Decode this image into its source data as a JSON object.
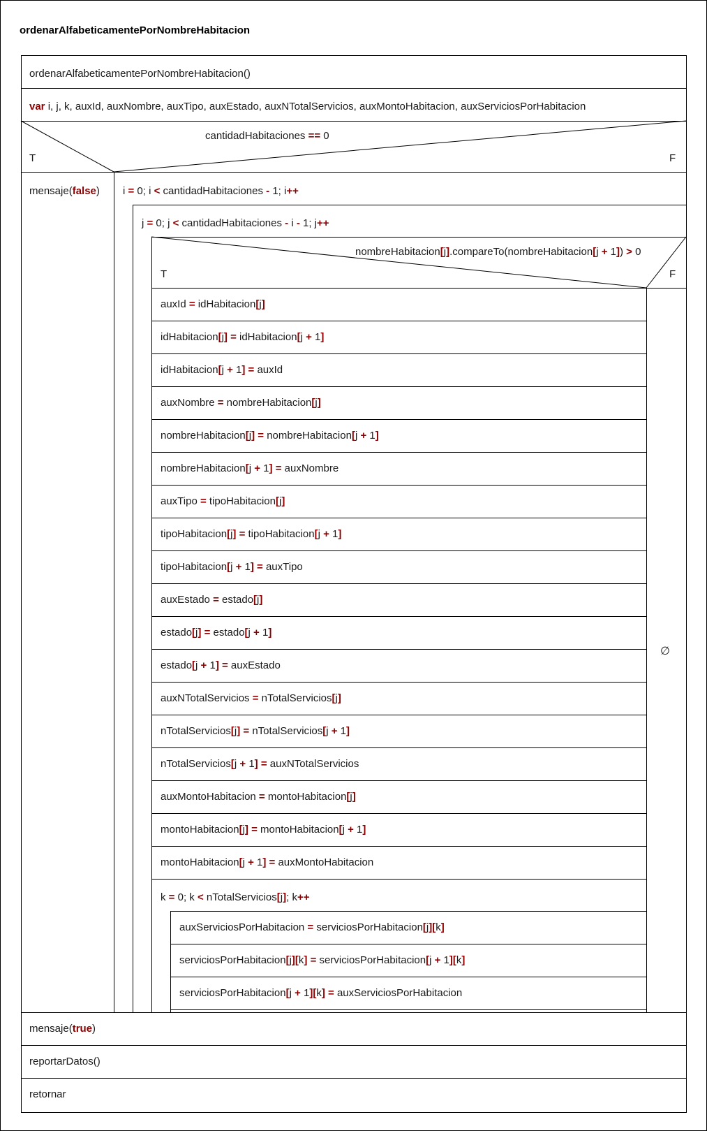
{
  "diagram": {
    "title": "ordenarAlfabeticamentePorNombreHabitacion",
    "header": [
      {
        "t": "ordenarAlfabeticamentePorNombreHabitacion()"
      }
    ],
    "var_line": [
      {
        "t": "var",
        "k": true
      },
      {
        "t": " i, j, k, auxId, auxNombre, auxTipo, auxEstado, auxNTotalServicios, auxMontoHabitacion, auxServiciosPorHabitacion"
      }
    ],
    "if1": {
      "condition": [
        {
          "t": "cantidadHabitaciones "
        },
        {
          "t": "==",
          "k": true
        },
        {
          "t": " 0"
        }
      ],
      "true_label": "T",
      "false_label": "F",
      "true_branch": [
        {
          "t": "mensaje("
        },
        {
          "t": "false",
          "k": true
        },
        {
          "t": ")"
        }
      ]
    },
    "loop_i": [
      {
        "t": "i "
      },
      {
        "t": "=",
        "k": true
      },
      {
        "t": " 0; i "
      },
      {
        "t": "<",
        "k": true
      },
      {
        "t": " cantidadHabitaciones "
      },
      {
        "t": "-",
        "k": true
      },
      {
        "t": " 1; i"
      },
      {
        "t": "++",
        "k": true
      }
    ],
    "loop_j": [
      {
        "t": "j "
      },
      {
        "t": "=",
        "k": true
      },
      {
        "t": " 0; j "
      },
      {
        "t": "<",
        "k": true
      },
      {
        "t": " cantidadHabitaciones "
      },
      {
        "t": "-",
        "k": true
      },
      {
        "t": " i "
      },
      {
        "t": "-",
        "k": true
      },
      {
        "t": " 1; j"
      },
      {
        "t": "++",
        "k": true
      }
    ],
    "if2": {
      "condition": [
        {
          "t": "nombreHabitacion"
        },
        {
          "t": "[",
          "k": true
        },
        {
          "t": "j"
        },
        {
          "t": "]",
          "k": true
        },
        {
          "t": ".compareTo(nombreHabitacion"
        },
        {
          "t": "[",
          "k": true
        },
        {
          "t": "j "
        },
        {
          "t": "+",
          "k": true
        },
        {
          "t": " 1"
        },
        {
          "t": "]",
          "k": true
        },
        {
          "t": ") "
        },
        {
          "t": ">",
          "k": true
        },
        {
          "t": " 0"
        }
      ],
      "true_label": "T",
      "false_label": "F",
      "false_branch": "∅"
    },
    "swap_statements": [
      [
        {
          "t": "auxId "
        },
        {
          "t": "=",
          "k": true
        },
        {
          "t": " idHabitacion"
        },
        {
          "t": "[",
          "k": true
        },
        {
          "t": "j"
        },
        {
          "t": "]",
          "k": true
        }
      ],
      [
        {
          "t": "idHabitacion"
        },
        {
          "t": "[",
          "k": true
        },
        {
          "t": "j"
        },
        {
          "t": "]",
          "k": true
        },
        {
          "t": " "
        },
        {
          "t": "=",
          "k": true
        },
        {
          "t": " idHabitacion"
        },
        {
          "t": "[",
          "k": true
        },
        {
          "t": "j "
        },
        {
          "t": "+",
          "k": true
        },
        {
          "t": " 1"
        },
        {
          "t": "]",
          "k": true
        }
      ],
      [
        {
          "t": "idHabitacion"
        },
        {
          "t": "[",
          "k": true
        },
        {
          "t": "j "
        },
        {
          "t": "+",
          "k": true
        },
        {
          "t": " 1"
        },
        {
          "t": "]",
          "k": true
        },
        {
          "t": " "
        },
        {
          "t": "=",
          "k": true
        },
        {
          "t": " auxId"
        }
      ],
      [
        {
          "t": "auxNombre "
        },
        {
          "t": "=",
          "k": true
        },
        {
          "t": " nombreHabitacion"
        },
        {
          "t": "[",
          "k": true
        },
        {
          "t": "j"
        },
        {
          "t": "]",
          "k": true
        }
      ],
      [
        {
          "t": "nombreHabitacion"
        },
        {
          "t": "[",
          "k": true
        },
        {
          "t": "j"
        },
        {
          "t": "]",
          "k": true
        },
        {
          "t": " "
        },
        {
          "t": "=",
          "k": true
        },
        {
          "t": " nombreHabitacion"
        },
        {
          "t": "[",
          "k": true
        },
        {
          "t": "j "
        },
        {
          "t": "+",
          "k": true
        },
        {
          "t": " 1"
        },
        {
          "t": "]",
          "k": true
        }
      ],
      [
        {
          "t": "nombreHabitacion"
        },
        {
          "t": "[",
          "k": true
        },
        {
          "t": "j "
        },
        {
          "t": "+",
          "k": true
        },
        {
          "t": " 1"
        },
        {
          "t": "]",
          "k": true
        },
        {
          "t": " "
        },
        {
          "t": "=",
          "k": true
        },
        {
          "t": " auxNombre"
        }
      ],
      [
        {
          "t": "auxTipo "
        },
        {
          "t": "=",
          "k": true
        },
        {
          "t": " tipoHabitacion"
        },
        {
          "t": "[",
          "k": true
        },
        {
          "t": "j"
        },
        {
          "t": "]",
          "k": true
        }
      ],
      [
        {
          "t": "tipoHabitacion"
        },
        {
          "t": "[",
          "k": true
        },
        {
          "t": "j"
        },
        {
          "t": "]",
          "k": true
        },
        {
          "t": " "
        },
        {
          "t": "=",
          "k": true
        },
        {
          "t": " tipoHabitacion"
        },
        {
          "t": "[",
          "k": true
        },
        {
          "t": "j "
        },
        {
          "t": "+",
          "k": true
        },
        {
          "t": " 1"
        },
        {
          "t": "]",
          "k": true
        }
      ],
      [
        {
          "t": "tipoHabitacion"
        },
        {
          "t": "[",
          "k": true
        },
        {
          "t": "j "
        },
        {
          "t": "+",
          "k": true
        },
        {
          "t": " 1"
        },
        {
          "t": "]",
          "k": true
        },
        {
          "t": " "
        },
        {
          "t": "=",
          "k": true
        },
        {
          "t": " auxTipo"
        }
      ],
      [
        {
          "t": "auxEstado "
        },
        {
          "t": "=",
          "k": true
        },
        {
          "t": " estado"
        },
        {
          "t": "[",
          "k": true
        },
        {
          "t": "j"
        },
        {
          "t": "]",
          "k": true
        }
      ],
      [
        {
          "t": "estado"
        },
        {
          "t": "[",
          "k": true
        },
        {
          "t": "j"
        },
        {
          "t": "]",
          "k": true
        },
        {
          "t": " "
        },
        {
          "t": "=",
          "k": true
        },
        {
          "t": " estado"
        },
        {
          "t": "[",
          "k": true
        },
        {
          "t": "j "
        },
        {
          "t": "+",
          "k": true
        },
        {
          "t": " 1"
        },
        {
          "t": "]",
          "k": true
        }
      ],
      [
        {
          "t": "estado"
        },
        {
          "t": "[",
          "k": true
        },
        {
          "t": "j "
        },
        {
          "t": "+",
          "k": true
        },
        {
          "t": " 1"
        },
        {
          "t": "]",
          "k": true
        },
        {
          "t": " "
        },
        {
          "t": "=",
          "k": true
        },
        {
          "t": " auxEstado"
        }
      ],
      [
        {
          "t": "auxNTotalServicios "
        },
        {
          "t": "=",
          "k": true
        },
        {
          "t": " nTotalServicios"
        },
        {
          "t": "[",
          "k": true
        },
        {
          "t": "j"
        },
        {
          "t": "]",
          "k": true
        }
      ],
      [
        {
          "t": "nTotalServicios"
        },
        {
          "t": "[",
          "k": true
        },
        {
          "t": "j"
        },
        {
          "t": "]",
          "k": true
        },
        {
          "t": " "
        },
        {
          "t": "=",
          "k": true
        },
        {
          "t": " nTotalServicios"
        },
        {
          "t": "[",
          "k": true
        },
        {
          "t": "j "
        },
        {
          "t": "+",
          "k": true
        },
        {
          "t": " 1"
        },
        {
          "t": "]",
          "k": true
        }
      ],
      [
        {
          "t": "nTotalServicios"
        },
        {
          "t": "[",
          "k": true
        },
        {
          "t": "j "
        },
        {
          "t": "+",
          "k": true
        },
        {
          "t": " 1"
        },
        {
          "t": "]",
          "k": true
        },
        {
          "t": " "
        },
        {
          "t": "=",
          "k": true
        },
        {
          "t": " auxNTotalServicios"
        }
      ],
      [
        {
          "t": "auxMontoHabitacion "
        },
        {
          "t": "=",
          "k": true
        },
        {
          "t": " montoHabitacion"
        },
        {
          "t": "[",
          "k": true
        },
        {
          "t": "j"
        },
        {
          "t": "]",
          "k": true
        }
      ],
      [
        {
          "t": "montoHabitacion"
        },
        {
          "t": "[",
          "k": true
        },
        {
          "t": "j"
        },
        {
          "t": "]",
          "k": true
        },
        {
          "t": " "
        },
        {
          "t": "=",
          "k": true
        },
        {
          "t": " montoHabitacion"
        },
        {
          "t": "[",
          "k": true
        },
        {
          "t": "j "
        },
        {
          "t": "+",
          "k": true
        },
        {
          "t": " 1"
        },
        {
          "t": "]",
          "k": true
        }
      ],
      [
        {
          "t": "montoHabitacion"
        },
        {
          "t": "[",
          "k": true
        },
        {
          "t": "j "
        },
        {
          "t": "+",
          "k": true
        },
        {
          "t": " 1"
        },
        {
          "t": "]",
          "k": true
        },
        {
          "t": " "
        },
        {
          "t": "=",
          "k": true
        },
        {
          "t": " auxMontoHabitacion"
        }
      ]
    ],
    "loop_k": [
      {
        "t": "k "
      },
      {
        "t": "=",
        "k": true
      },
      {
        "t": " 0; k "
      },
      {
        "t": "<",
        "k": true
      },
      {
        "t": " nTotalServicios"
      },
      {
        "t": "[",
        "k": true
      },
      {
        "t": "j"
      },
      {
        "t": "]",
        "k": true
      },
      {
        "t": "; k"
      },
      {
        "t": "++",
        "k": true
      }
    ],
    "k_statements": [
      [
        {
          "t": "auxServiciosPorHabitacion "
        },
        {
          "t": "=",
          "k": true
        },
        {
          "t": " serviciosPorHabitacion"
        },
        {
          "t": "[",
          "k": true
        },
        {
          "t": "j"
        },
        {
          "t": "][",
          "k": true
        },
        {
          "t": "k"
        },
        {
          "t": "]",
          "k": true
        }
      ],
      [
        {
          "t": "serviciosPorHabitacion"
        },
        {
          "t": "[",
          "k": true
        },
        {
          "t": "j"
        },
        {
          "t": "][",
          "k": true
        },
        {
          "t": "k"
        },
        {
          "t": "]",
          "k": true
        },
        {
          "t": " "
        },
        {
          "t": "=",
          "k": true
        },
        {
          "t": " serviciosPorHabitacion"
        },
        {
          "t": "[",
          "k": true
        },
        {
          "t": "j "
        },
        {
          "t": "+",
          "k": true
        },
        {
          "t": " 1"
        },
        {
          "t": "][",
          "k": true
        },
        {
          "t": "k"
        },
        {
          "t": "]",
          "k": true
        }
      ],
      [
        {
          "t": "serviciosPorHabitacion"
        },
        {
          "t": "[",
          "k": true
        },
        {
          "t": "j "
        },
        {
          "t": "+",
          "k": true
        },
        {
          "t": " 1"
        },
        {
          "t": "][",
          "k": true
        },
        {
          "t": "k"
        },
        {
          "t": "]",
          "k": true
        },
        {
          "t": " "
        },
        {
          "t": "=",
          "k": true
        },
        {
          "t": " auxServiciosPorHabitacion"
        }
      ]
    ],
    "footer": [
      [
        {
          "t": "mensaje("
        },
        {
          "t": "true",
          "k": true
        },
        {
          "t": ")"
        }
      ],
      [
        {
          "t": "reportarDatos()"
        }
      ],
      [
        {
          "t": "retornar"
        }
      ]
    ],
    "colors": {
      "keyword": "#8b0000",
      "text": "#1a1a1a",
      "line": "#000000"
    }
  }
}
